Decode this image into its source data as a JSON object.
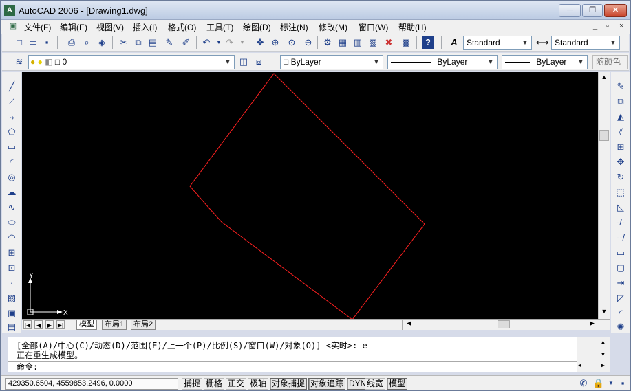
{
  "window": {
    "title": "AutoCAD 2006 - [Drawing1.dwg]",
    "app_icon": "A",
    "controls": [
      "─",
      "❐",
      "✕"
    ]
  },
  "menubar": {
    "items": [
      "文件(F)",
      "编辑(E)",
      "视图(V)",
      "插入(I)",
      "格式(O)",
      "工具(T)",
      "绘图(D)",
      "标注(N)",
      "修改(M)",
      "窗口(W)",
      "帮助(H)"
    ],
    "mdi_controls": [
      "_",
      "▫",
      "×"
    ]
  },
  "toolbar_style": {
    "text_style": "Standard",
    "dim_style": "Standard"
  },
  "toolbar_layers": {
    "layer_name": "0",
    "color": "ByLayer",
    "linetype": "ByLayer",
    "lineweight": "ByLayer",
    "plot_style": "随颜色"
  },
  "layout_tabs": [
    "模型",
    "布局1",
    "布局2"
  ],
  "ucs": {
    "y_label": "Y",
    "x_label": "X"
  },
  "command": {
    "history": [
      "[全部(A)/中心(C)/动态(D)/范围(E)/上一个(P)/比例(S)/窗口(W)/对象(O)] <实时>: e",
      "正在重生成模型。"
    ],
    "prompt": "命令:"
  },
  "status": {
    "coords": "429350.6504, 4559853.2496, 0.0000",
    "toggles": [
      "捕捉",
      "栅格",
      "正交",
      "极轴",
      "对象捕捉",
      "对象追踪",
      "DYN",
      "线宽",
      "模型"
    ]
  },
  "colors": {
    "canvas_bg": "#000000",
    "drawing_line": "#ff2020",
    "ucs": "#ffffff"
  }
}
